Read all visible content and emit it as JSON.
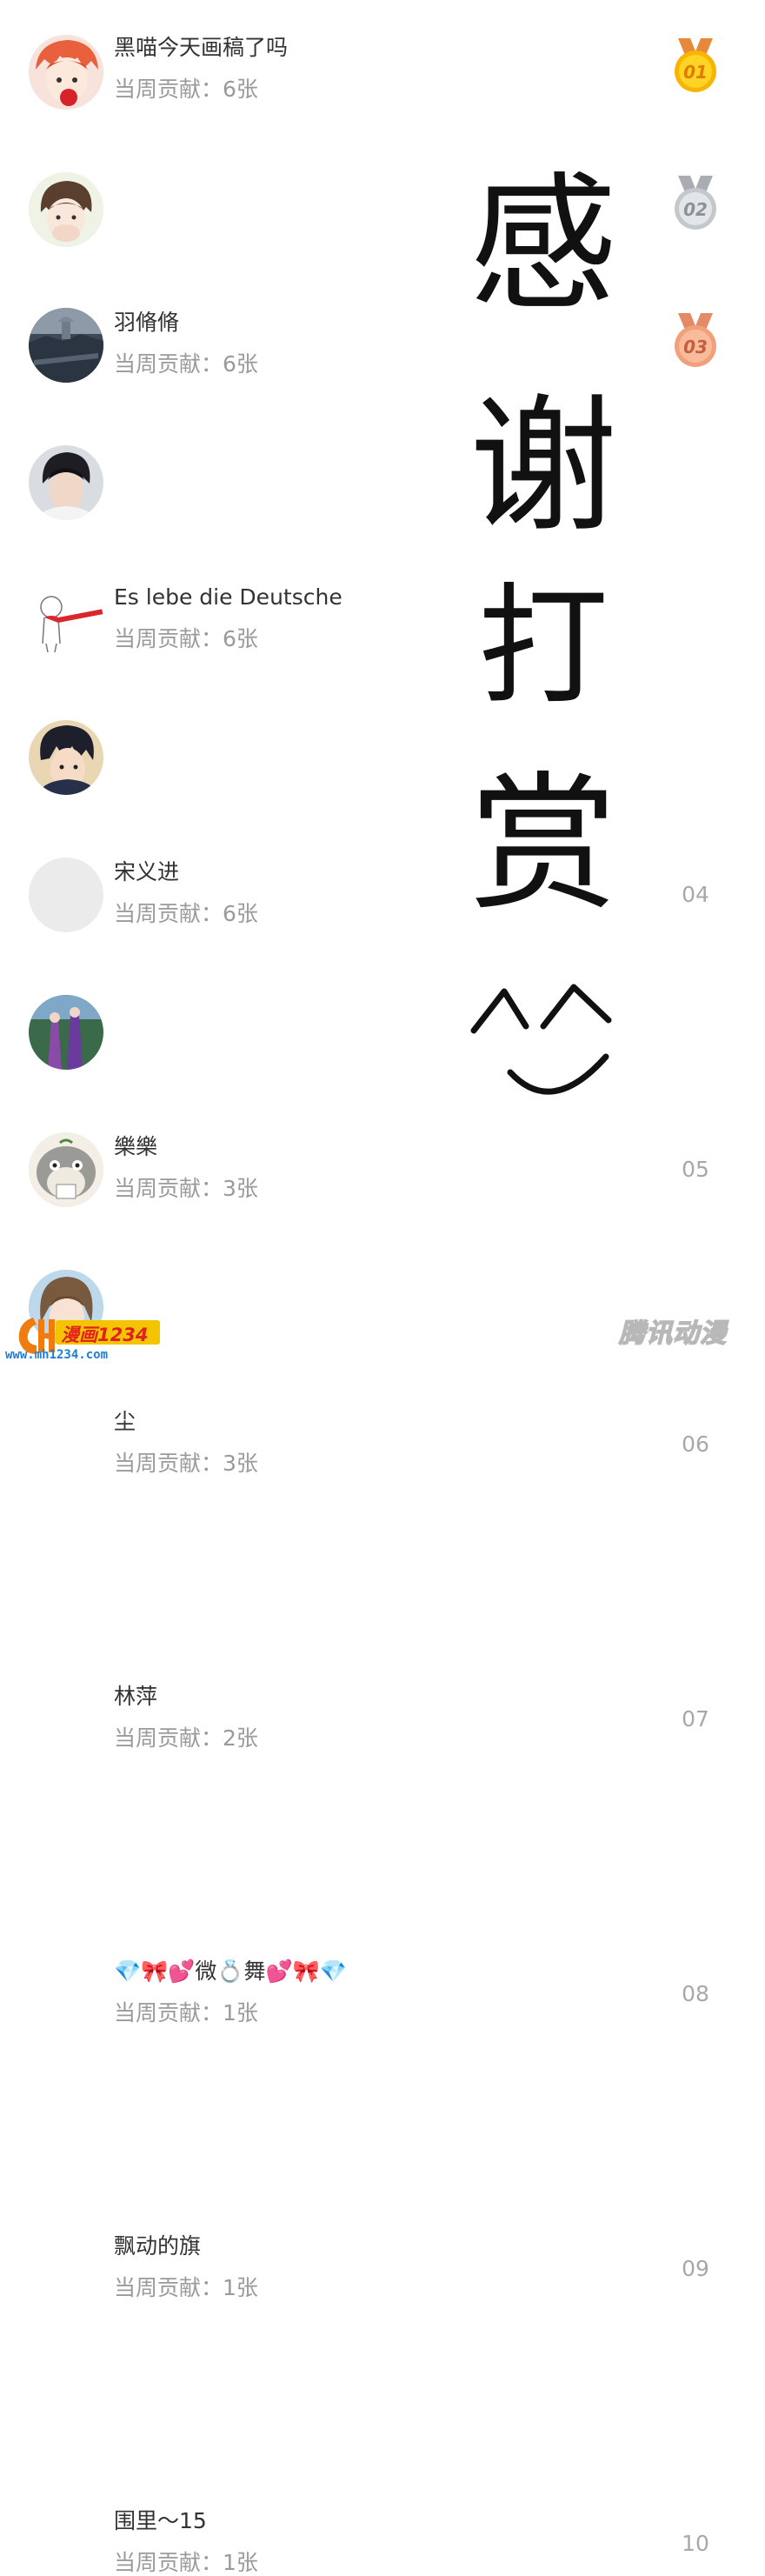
{
  "ranking": [
    {
      "rank": "01",
      "name": "黑喵今天画稿了吗",
      "contribution": "当周贡献：6张",
      "avatar": "red-haired-character",
      "medal": "gold"
    },
    {
      "rank": "02",
      "name": "羽脩脩",
      "contribution": "当周贡献：6张",
      "avatar": "brown-haired-boy",
      "medal": "silver"
    },
    {
      "rank": "03",
      "name": "Es lebe die Deutsche",
      "contribution": "当周贡献：6张",
      "avatar": "city-aerial-view",
      "medal": "bronze"
    },
    {
      "rank": "04",
      "name": "宋义进",
      "contribution": "当周贡献：6张",
      "avatar": "young-man-photo",
      "medal": null
    },
    {
      "rank": "05",
      "name": "樂樂",
      "contribution": "当周贡献：3张",
      "avatar": "sketch-girl-red-scarf",
      "medal": null
    },
    {
      "rank": "06",
      "name": "尘",
      "contribution": "当周贡献：3张",
      "avatar": "anime-boy",
      "medal": null
    },
    {
      "rank": "07",
      "name": "林萍",
      "contribution": "当周贡献：2张",
      "avatar": "empty-placeholder",
      "medal": null
    },
    {
      "rank": "08",
      "name": "💎🎀💕微💍舞💕🎀💎",
      "contribution": "当周贡献：1张",
      "avatar": "game-characters",
      "medal": null
    },
    {
      "rank": "09",
      "name": "飘动的旗",
      "contribution": "当周贡献：1张",
      "avatar": "totoro",
      "medal": null
    },
    {
      "rank": "10",
      "name": "围里～15",
      "contribution": "当周贡献：1张",
      "avatar": "anime-girl",
      "medal": null
    }
  ],
  "overlay_text": [
    "感",
    "谢",
    "打",
    "赏",
    "^",
    "^"
  ],
  "watermark": {
    "left_badge": "漫画1234",
    "site": "www.mh1234.com",
    "right": "腾讯动漫"
  },
  "colors": {
    "gold": "#f7b500",
    "silver": "#c4c8cc",
    "bronze": "#f2a07a",
    "ribbon_gold": "#e8893a",
    "ribbon_silver": "#a9adb2",
    "ribbon_bronze": "#e58a66"
  }
}
